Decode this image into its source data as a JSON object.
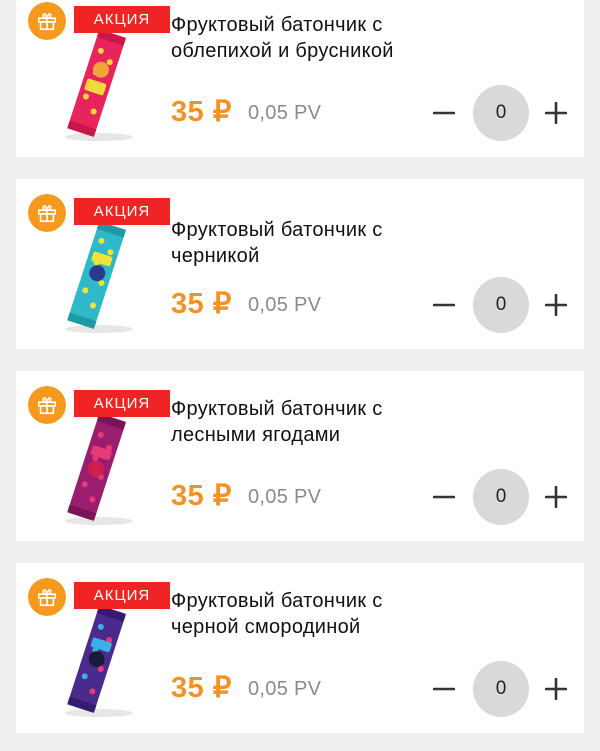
{
  "products": [
    {
      "promo_label": "АКЦИЯ",
      "title": "Фруктовый батончик с\nоблепихой и брусникой",
      "price": "35 ₽",
      "pv": "0,05 PV",
      "quantity": "0",
      "wrapper_colors": [
        "#e8245c",
        "#f2d93a"
      ]
    },
    {
      "promo_label": "АКЦИЯ",
      "title": "Фруктовый батончик с черникой",
      "price": "35 ₽",
      "pv": "0,05 PV",
      "quantity": "0",
      "wrapper_colors": [
        "#2fb8c8",
        "#f2e23a"
      ]
    },
    {
      "promo_label": "АКЦИЯ",
      "title": "Фруктовый батончик с\nлесными ягодами",
      "price": "35 ₽",
      "pv": "0,05 PV",
      "quantity": "0",
      "wrapper_colors": [
        "#9b1e6e",
        "#e83a7a"
      ]
    },
    {
      "promo_label": "АКЦИЯ",
      "title": "Фруктовый батончик с\nчерной смородиной",
      "price": "35 ₽",
      "pv": "0,05 PV",
      "quantity": "0",
      "wrapper_colors": [
        "#4a2a8c",
        "#3bb0e6"
      ]
    }
  ],
  "icons": {
    "gift": "gift-icon",
    "minus": "minus-icon",
    "plus": "plus-icon"
  },
  "colors": {
    "accent": "#f4912b",
    "promo": "#f02424",
    "gift_bg": "#f59a1e"
  }
}
